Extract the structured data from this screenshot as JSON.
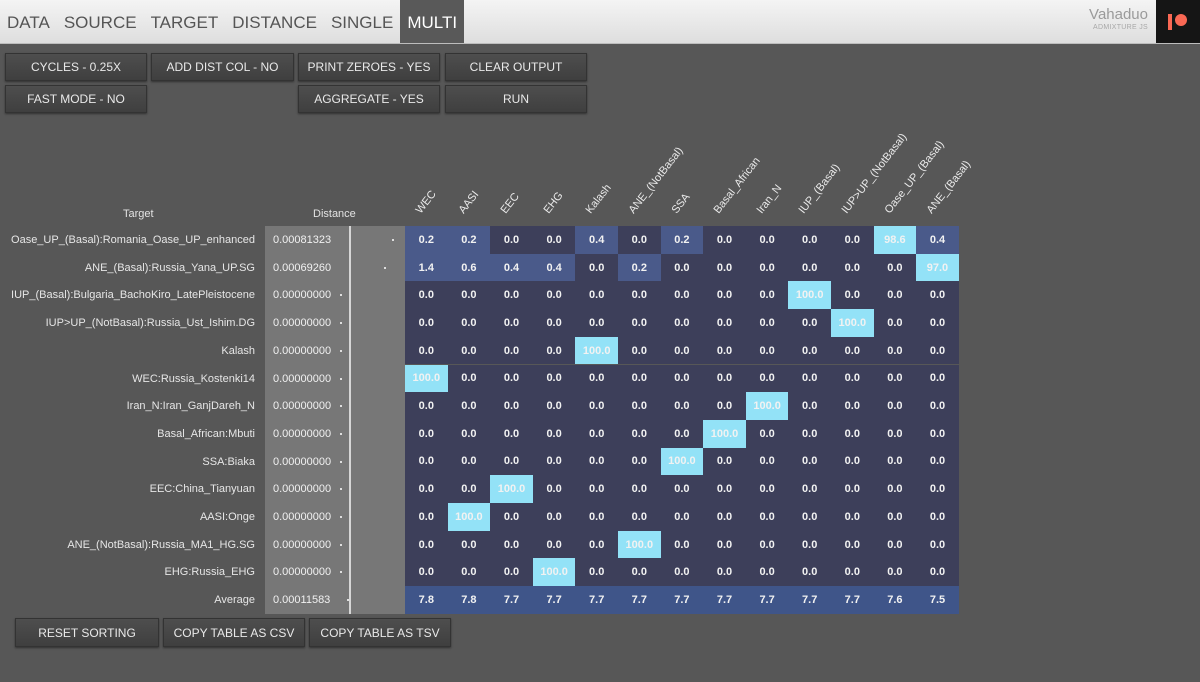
{
  "nav": {
    "tabs": [
      {
        "label": "DATA"
      },
      {
        "label": "SOURCE"
      },
      {
        "label": "TARGET"
      },
      {
        "label": "DISTANCE"
      },
      {
        "label": "SINGLE"
      },
      {
        "label": "MULTI"
      }
    ],
    "active_tab": "MULTI",
    "brand_name": "Vahaduo",
    "brand_sub": "ADMIXTURE JS"
  },
  "options": {
    "cycles": "CYCLES - 0.25X",
    "add_dist_col": "ADD DIST COL - NO",
    "print_zeroes": "PRINT ZEROES - YES",
    "clear_output": "CLEAR OUTPUT",
    "fast_mode": "FAST MODE - NO",
    "aggregate": "AGGREGATE - YES",
    "run": "RUN"
  },
  "table": {
    "target_header": "Target",
    "distance_header": "Distance",
    "columns": [
      "WEC",
      "AASI",
      "EEC",
      "EHG",
      "Kalash",
      "ANE_(NotBasal)",
      "SSA",
      "Basal_African",
      "Iran_N",
      "IUP_(Basal)",
      "IUP>UP_(NotBasal)",
      "Oase_UP_(Basal)",
      "ANE_(Basal)"
    ],
    "rows": [
      {
        "target": "Oase_UP_(Basal):Romania_Oase_UP_enhanced",
        "distance": "0.00081323",
        "values": [
          "0.2",
          "0.2",
          "0.0",
          "0.0",
          "0.4",
          "0.0",
          "0.2",
          "0.0",
          "0.0",
          "0.0",
          "0.0",
          "98.6",
          "0.4"
        ]
      },
      {
        "target": "ANE_(Basal):Russia_Yana_UP.SG",
        "distance": "0.00069260",
        "values": [
          "1.4",
          "0.6",
          "0.4",
          "0.4",
          "0.0",
          "0.2",
          "0.0",
          "0.0",
          "0.0",
          "0.0",
          "0.0",
          "0.0",
          "97.0"
        ]
      },
      {
        "target": "IUP_(Basal):Bulgaria_BachoKiro_LatePleistocene",
        "distance": "0.00000000",
        "values": [
          "0.0",
          "0.0",
          "0.0",
          "0.0",
          "0.0",
          "0.0",
          "0.0",
          "0.0",
          "0.0",
          "100.0",
          "0.0",
          "0.0",
          "0.0"
        ]
      },
      {
        "target": "IUP>UP_(NotBasal):Russia_Ust_Ishim.DG",
        "distance": "0.00000000",
        "values": [
          "0.0",
          "0.0",
          "0.0",
          "0.0",
          "0.0",
          "0.0",
          "0.0",
          "0.0",
          "0.0",
          "0.0",
          "100.0",
          "0.0",
          "0.0"
        ]
      },
      {
        "target": "Kalash",
        "distance": "0.00000000",
        "values": [
          "0.0",
          "0.0",
          "0.0",
          "0.0",
          "100.0",
          "0.0",
          "0.0",
          "0.0",
          "0.0",
          "0.0",
          "0.0",
          "0.0",
          "0.0"
        ]
      },
      {
        "target": "WEC:Russia_Kostenki14",
        "distance": "0.00000000",
        "values": [
          "100.0",
          "0.0",
          "0.0",
          "0.0",
          "0.0",
          "0.0",
          "0.0",
          "0.0",
          "0.0",
          "0.0",
          "0.0",
          "0.0",
          "0.0"
        ]
      },
      {
        "target": "Iran_N:Iran_GanjDareh_N",
        "distance": "0.00000000",
        "values": [
          "0.0",
          "0.0",
          "0.0",
          "0.0",
          "0.0",
          "0.0",
          "0.0",
          "0.0",
          "100.0",
          "0.0",
          "0.0",
          "0.0",
          "0.0"
        ]
      },
      {
        "target": "Basal_African:Mbuti",
        "distance": "0.00000000",
        "values": [
          "0.0",
          "0.0",
          "0.0",
          "0.0",
          "0.0",
          "0.0",
          "0.0",
          "100.0",
          "0.0",
          "0.0",
          "0.0",
          "0.0",
          "0.0"
        ]
      },
      {
        "target": "SSA:Biaka",
        "distance": "0.00000000",
        "values": [
          "0.0",
          "0.0",
          "0.0",
          "0.0",
          "0.0",
          "0.0",
          "100.0",
          "0.0",
          "0.0",
          "0.0",
          "0.0",
          "0.0",
          "0.0"
        ]
      },
      {
        "target": "EEC:China_Tianyuan",
        "distance": "0.00000000",
        "values": [
          "0.0",
          "0.0",
          "100.0",
          "0.0",
          "0.0",
          "0.0",
          "0.0",
          "0.0",
          "0.0",
          "0.0",
          "0.0",
          "0.0",
          "0.0"
        ]
      },
      {
        "target": "AASI:Onge",
        "distance": "0.00000000",
        "values": [
          "0.0",
          "100.0",
          "0.0",
          "0.0",
          "0.0",
          "0.0",
          "0.0",
          "0.0",
          "0.0",
          "0.0",
          "0.0",
          "0.0",
          "0.0"
        ]
      },
      {
        "target": "ANE_(NotBasal):Russia_MA1_HG.SG",
        "distance": "0.00000000",
        "values": [
          "0.0",
          "0.0",
          "0.0",
          "0.0",
          "0.0",
          "100.0",
          "0.0",
          "0.0",
          "0.0",
          "0.0",
          "0.0",
          "0.0",
          "0.0"
        ]
      },
      {
        "target": "EHG:Russia_EHG",
        "distance": "0.00000000",
        "values": [
          "0.0",
          "0.0",
          "0.0",
          "100.0",
          "0.0",
          "0.0",
          "0.0",
          "0.0",
          "0.0",
          "0.0",
          "0.0",
          "0.0",
          "0.0"
        ]
      }
    ],
    "average": {
      "target": "Average",
      "distance": "0.00011583",
      "values": [
        "7.8",
        "7.8",
        "7.7",
        "7.7",
        "7.7",
        "7.7",
        "7.7",
        "7.7",
        "7.7",
        "7.7",
        "7.7",
        "7.6",
        "7.5"
      ]
    },
    "colors": {
      "zero": "#3d3f5a",
      "low": "#4a5a8a",
      "average": "#3f5589",
      "high": "#93e2f7"
    }
  },
  "bottom": {
    "reset_sorting": "RESET SORTING",
    "copy_csv": "COPY TABLE AS CSV",
    "copy_tsv": "COPY TABLE AS TSV"
  }
}
